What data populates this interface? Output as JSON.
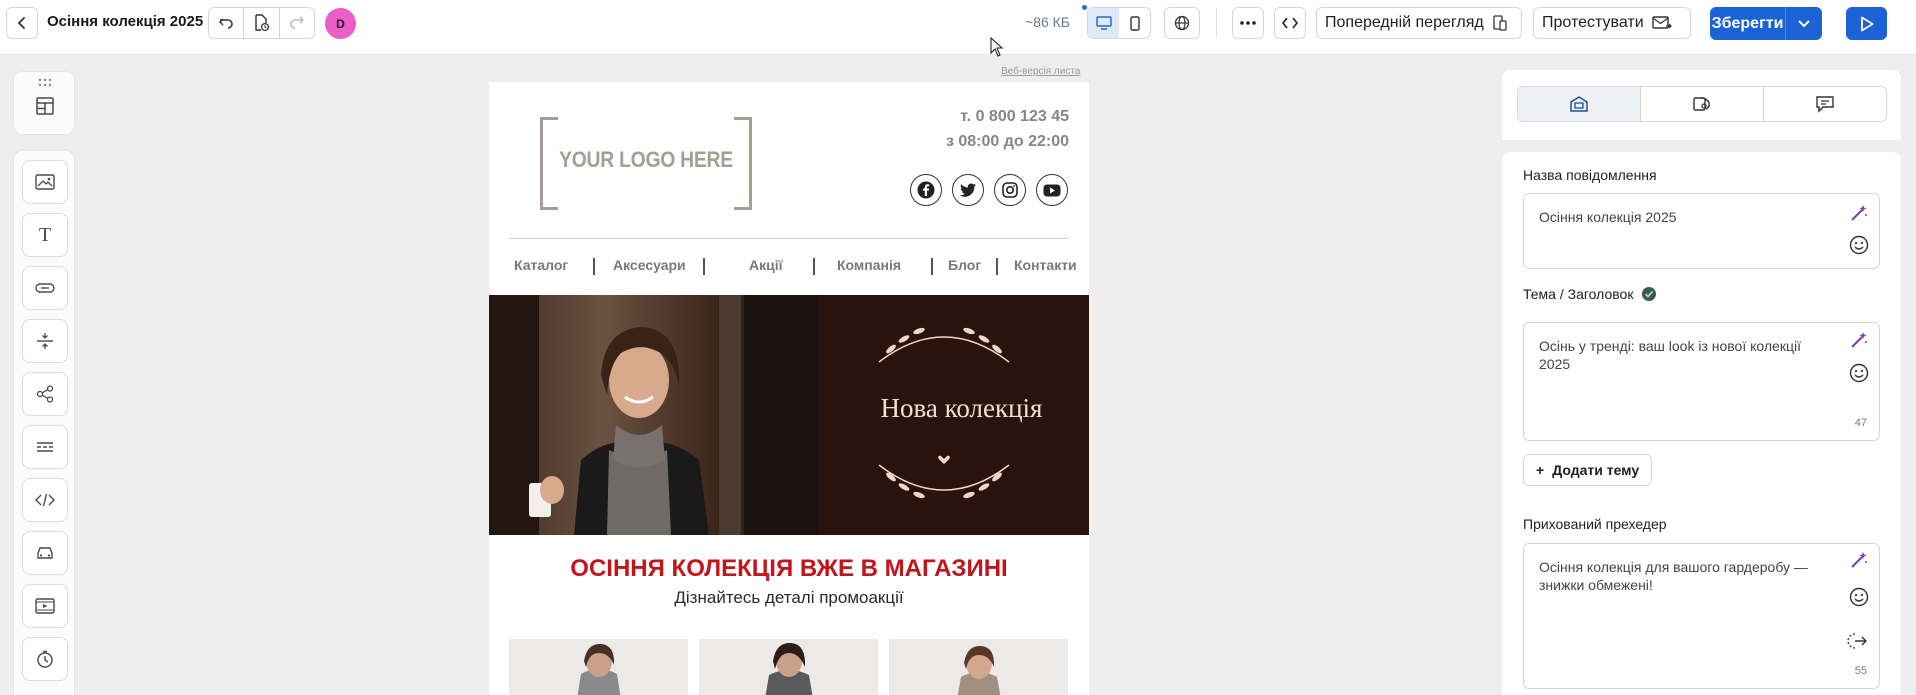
{
  "header": {
    "title": "Осіння колекція 2025",
    "avatar_initial": "D",
    "size": "~86 КБ",
    "preview_label": "Попередній перегляд",
    "test_label": "Протестувати",
    "save_label": "Зберегти"
  },
  "email": {
    "web_version": "Веб-версія листа",
    "logo_text": "YOUR LOGO HERE",
    "phone": "т. 0 800 123 45",
    "hours": "з 08:00 до 22:00",
    "nav": [
      "Каталог",
      "Аксесуари",
      "Акції",
      "Компанія",
      "Блог",
      "Контакти"
    ],
    "hero_text": "Нова колекція",
    "headline": "ОСІННЯ КОЛЕКЦІЯ ВЖЕ В МАГАЗИНІ",
    "subline": "Дізнайтесь деталі промоакції"
  },
  "panel": {
    "name_label": "Назва повідомлення",
    "name_value": "Осіння колекція 2025",
    "subject_label": "Тема / Заголовок",
    "subject_value": "Осінь у тренді: ваш look із нової колекції 2025",
    "subject_count": "47",
    "add_subject": "Додати тему",
    "preheader_label": "Прихований прехедер",
    "preheader_value": "Осіння колекція для вашого гардеробу — знижки обмежені!",
    "preheader_count": "55"
  },
  "colors": {
    "primary": "#1b62d6",
    "headline": "#c2151b",
    "avatar": "#e95ec7"
  }
}
